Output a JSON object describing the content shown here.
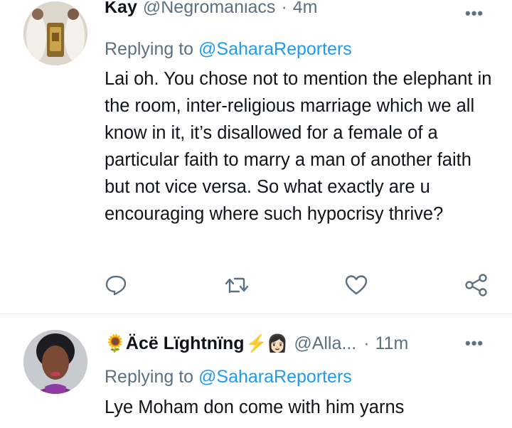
{
  "tweet1": {
    "display_name": "Kay",
    "handle": "@Negromaniacs",
    "time": "4m",
    "replying_label": "Replying to",
    "replying_to": "@SaharaReporters",
    "text": "Lai oh. You chose not to mention the elephant in the room, inter-religious marriage which we all know in it, it’s disallowed for a female of a particular faith to marry a man of another faith but not vice versa. So what exactly are u encouraging where such hypocrisy thrive?"
  },
  "tweet2": {
    "name_prefix_emoji": "🌻",
    "display_name": "Äcë Lïghtnïng",
    "name_suffix_emoji": "⚡👩🏻",
    "handle": "@Alla...",
    "separator": "·",
    "time": "11m",
    "replying_label": "Replying to",
    "replying_to": "@SaharaReporters",
    "text": "Lye Moham don come with him yarns"
  },
  "icons": {
    "more": "more-horizontal-icon",
    "reply": "reply-bubble-icon",
    "retweet": "retweet-icon",
    "like": "heart-icon",
    "share": "share-icon"
  },
  "colors": {
    "text": "#0f1419",
    "muted": "#5b7083",
    "accent": "#1d9bf0",
    "divider": "#e1e8ed"
  }
}
